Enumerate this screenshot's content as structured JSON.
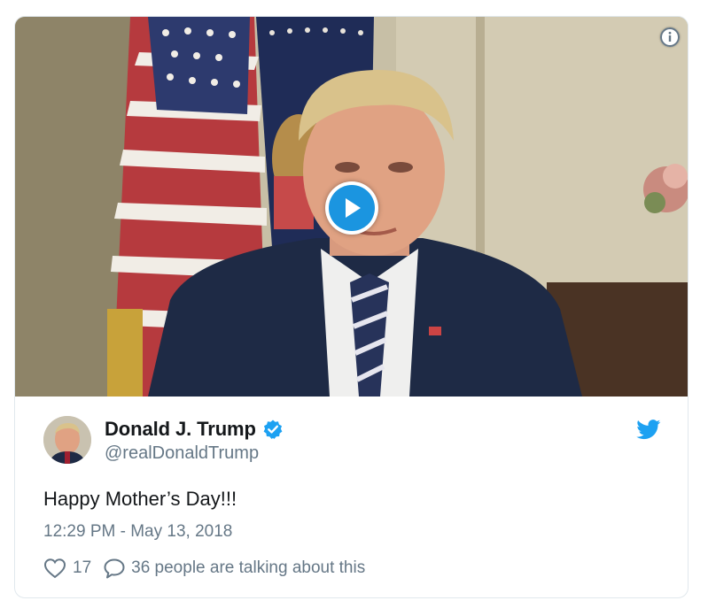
{
  "media": {
    "info_icon": "info-icon",
    "play_icon": "play-icon"
  },
  "tweet": {
    "author_name": "Donald J. Trump",
    "handle": "@realDonaldTrump",
    "verified_icon": "verified-badge-icon",
    "platform_icon": "twitter-bird-icon",
    "text": "Happy Mother’s Day!!!",
    "timestamp": "12:29 PM - May 13, 2018",
    "like_count": "17",
    "talking_text": "36 people are talking about this"
  },
  "colors": {
    "accent": "#1b95e0",
    "text_primary": "#14171a",
    "text_secondary": "#657786",
    "border": "#e1e8ed"
  }
}
